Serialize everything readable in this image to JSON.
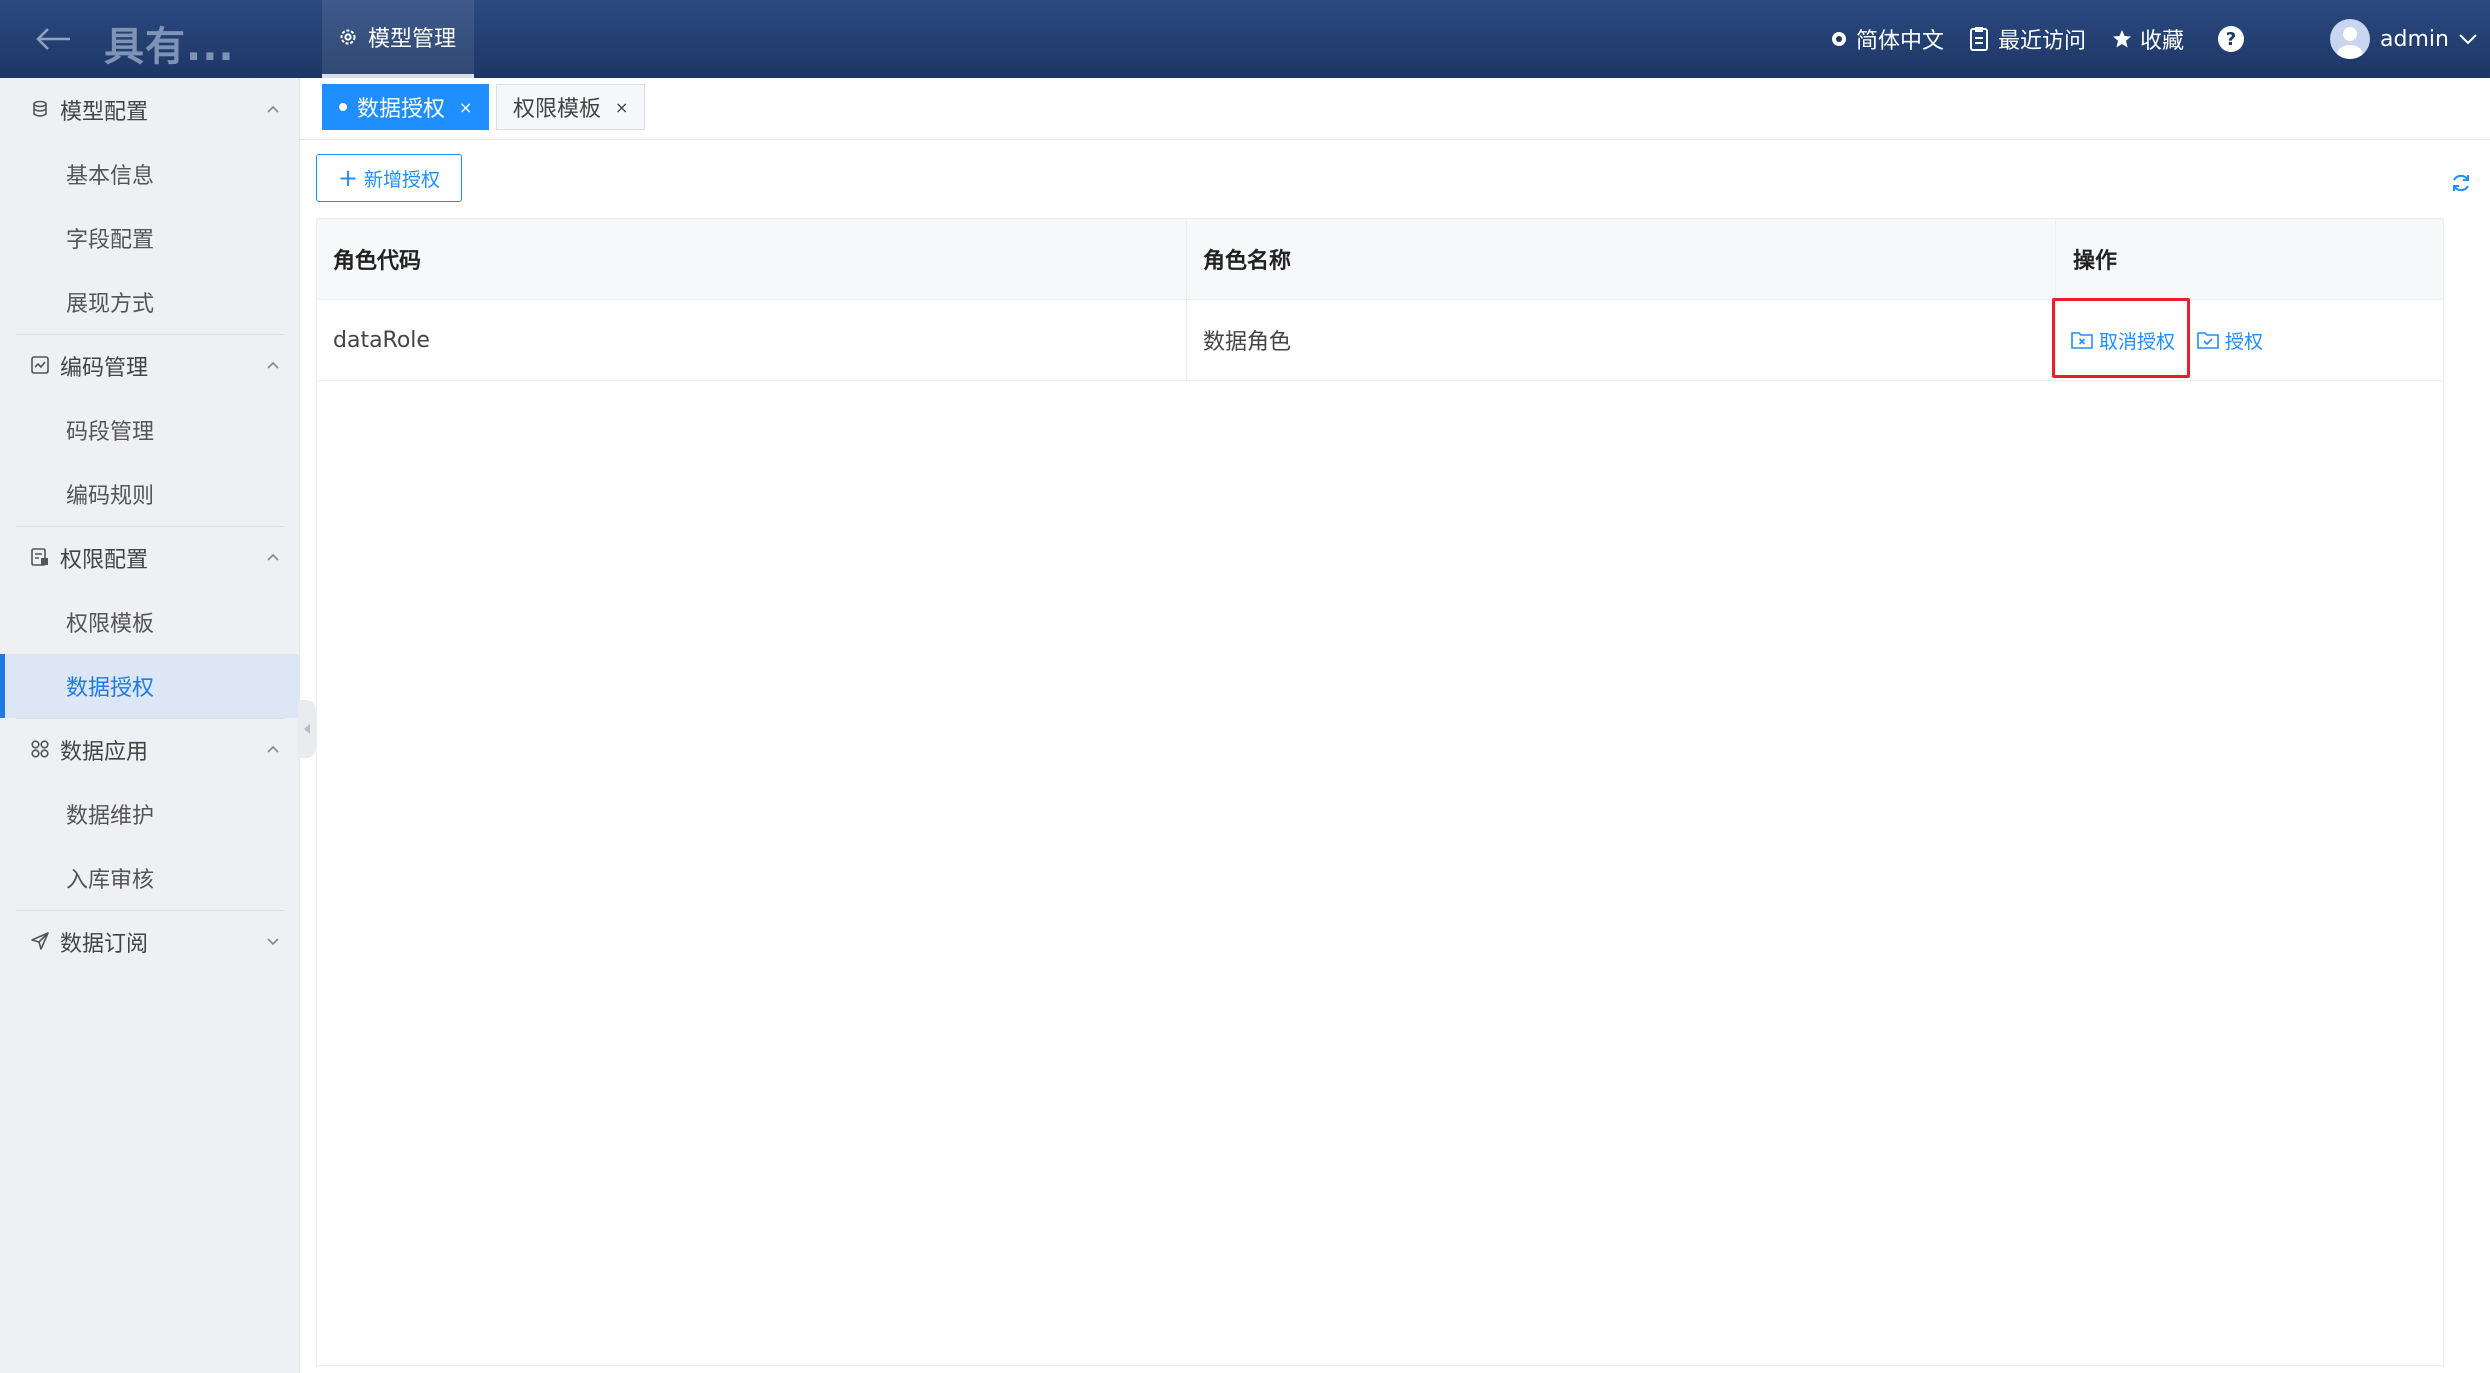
{
  "header": {
    "app_title": "具有...",
    "top_tab": "模型管理",
    "language": "简体中文",
    "recent": "最近访问",
    "favorites": "收藏",
    "help": "?",
    "user": "admin"
  },
  "sidebar": {
    "groups": [
      {
        "label": "模型配置",
        "items": [
          "基本信息",
          "字段配置",
          "展现方式"
        ]
      },
      {
        "label": "编码管理",
        "items": [
          "码段管理",
          "编码规则"
        ]
      },
      {
        "label": "权限配置",
        "items": [
          "权限模板",
          "数据授权"
        ]
      },
      {
        "label": "数据应用",
        "items": [
          "数据维护",
          "入库审核"
        ]
      },
      {
        "label": "数据订阅",
        "items": []
      }
    ],
    "active_item": "数据授权"
  },
  "page_tabs": [
    {
      "label": "数据授权",
      "close": "×",
      "active": true
    },
    {
      "label": "权限模板",
      "close": "×",
      "active": false
    }
  ],
  "toolbar": {
    "add_label": "新增授权",
    "add_plus": "+"
  },
  "table": {
    "columns": [
      "角色代码",
      "角色名称",
      "操作"
    ],
    "rows": [
      {
        "code": "dataRole",
        "name": "数据角色",
        "actions": [
          "取消授权",
          "授权"
        ]
      }
    ]
  },
  "colors": {
    "accent": "#1f8fff",
    "header_bg": "#1d3665",
    "highlight": "#e8202a"
  }
}
